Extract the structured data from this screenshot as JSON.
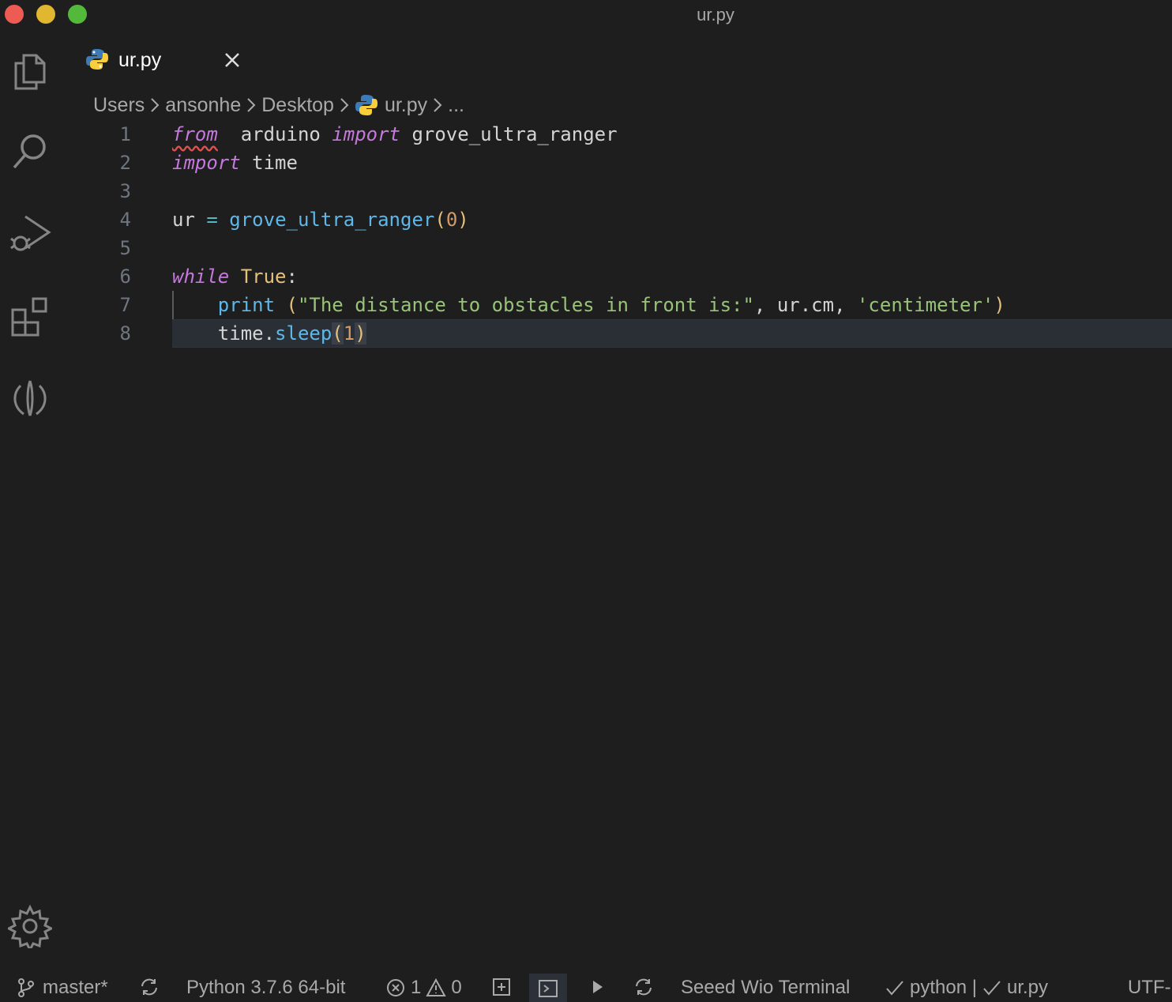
{
  "window": {
    "title": "ur.py"
  },
  "tab": {
    "label": "ur.py"
  },
  "breadcrumb": [
    "Users",
    "ansonhe",
    "Desktop",
    "ur.py",
    "..."
  ],
  "editor": {
    "line_numbers": [
      "1",
      "2",
      "3",
      "4",
      "5",
      "6",
      "7",
      "8"
    ],
    "lines": [
      [
        [
          "kw squiggle",
          "from"
        ],
        [
          "",
          "  arduino "
        ],
        [
          "kw",
          "import"
        ],
        [
          "",
          " grove_ultra_ranger"
        ]
      ],
      [
        [
          "kw",
          "import"
        ],
        [
          "",
          " time"
        ]
      ],
      [],
      [
        [
          "",
          "ur "
        ],
        [
          "op",
          "="
        ],
        [
          "",
          " "
        ],
        [
          "fn",
          "grove_ultra_ranger"
        ],
        [
          "br",
          "("
        ],
        [
          "num",
          "0"
        ],
        [
          "br",
          ")"
        ]
      ],
      [],
      [
        [
          "kw",
          "while"
        ],
        [
          "",
          " "
        ],
        [
          "cls",
          "True"
        ],
        [
          "",
          ":"
        ]
      ],
      [
        [
          "",
          "    "
        ],
        [
          "fn",
          "print"
        ],
        [
          "",
          " "
        ],
        [
          "br",
          "("
        ],
        [
          "str",
          "\"The distance to obstacles in front is:\""
        ],
        [
          "",
          ", ur.cm, "
        ],
        [
          "str",
          "'centimeter'"
        ],
        [
          "br",
          ")"
        ]
      ],
      [
        [
          "",
          "    time."
        ],
        [
          "fn",
          "sleep"
        ],
        [
          "br match",
          "("
        ],
        [
          "num",
          "1"
        ],
        [
          "br match",
          ")"
        ]
      ]
    ]
  },
  "statusbar": {
    "branch": "master*",
    "interpreter": "Python 3.7.6 64-bit",
    "errors": "1",
    "warnings": "0",
    "board": "Seeed Wio Terminal",
    "language_check": "python |",
    "file_check": "ur.py",
    "encoding": "UTF-"
  },
  "colors": {
    "background": "#1e1e1e",
    "keyword": "#c678dd",
    "function": "#5eb7e8",
    "string": "#98c379",
    "number": "#d19a66"
  }
}
